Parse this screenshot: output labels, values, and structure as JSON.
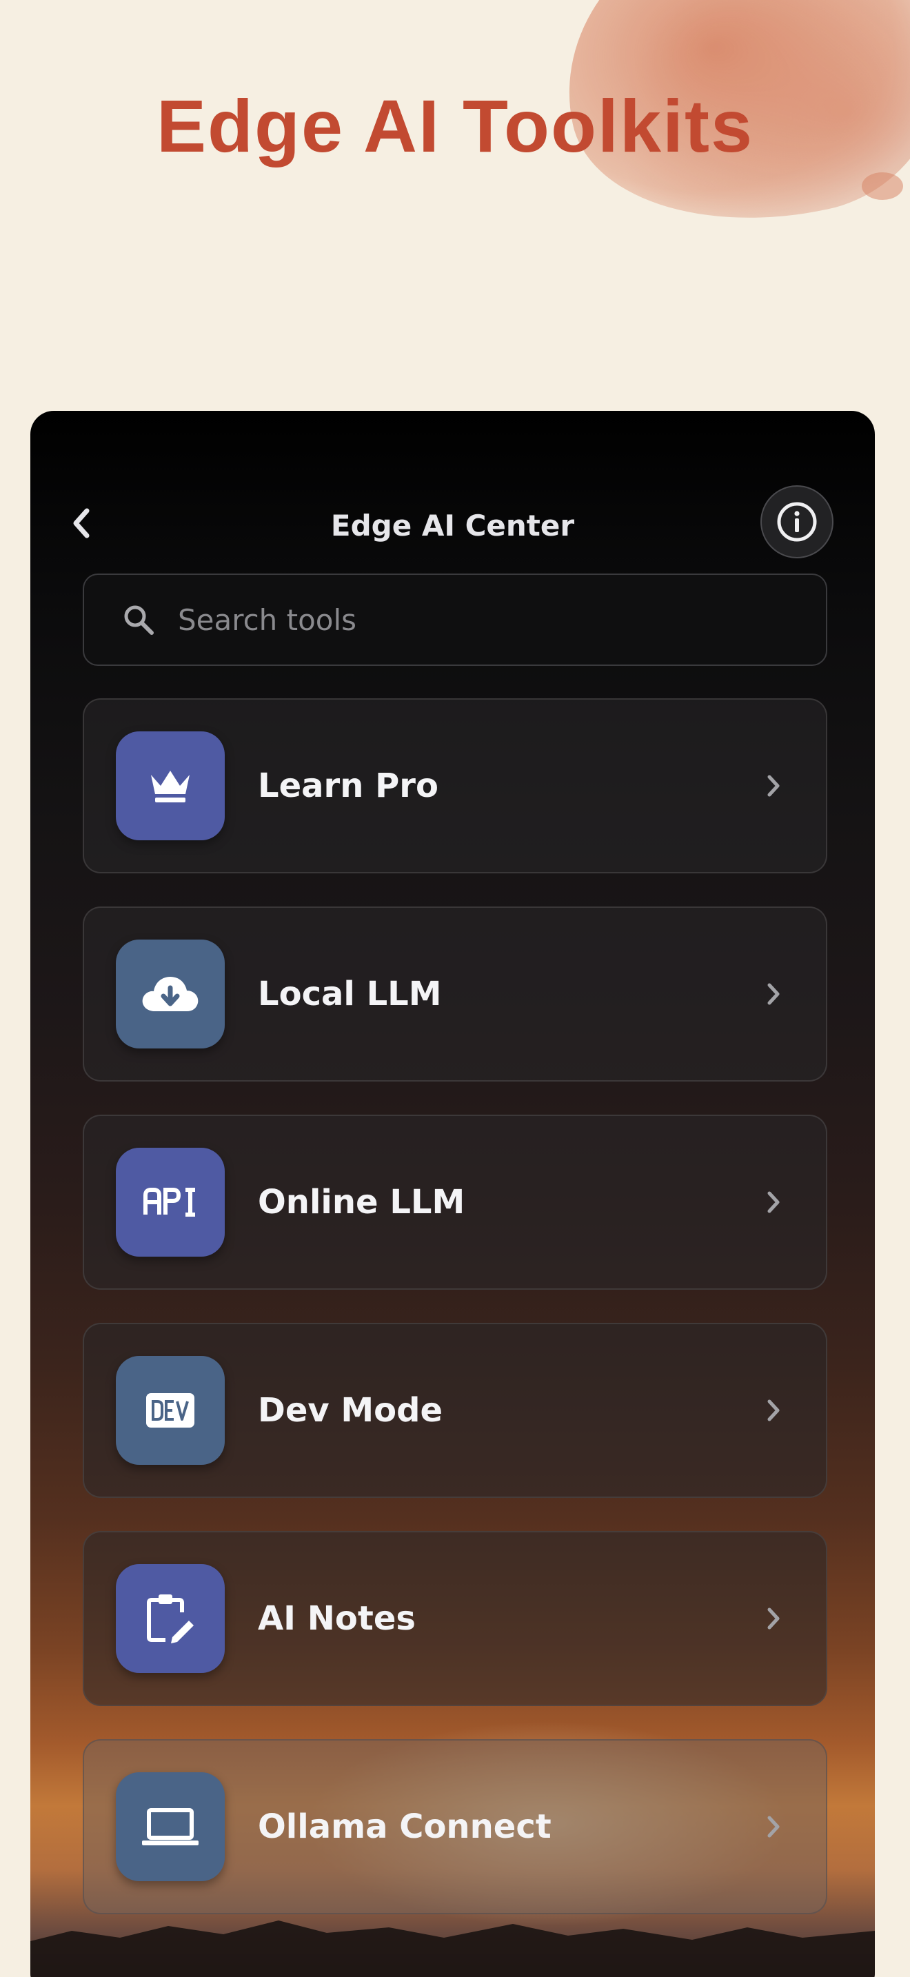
{
  "headline": "Edge AI Toolkits",
  "colors": {
    "headline": "#c24a31",
    "page_background": "#f6efe2",
    "icon_indigo": "#4f5aa3",
    "icon_slate": "#4a6487"
  },
  "navbar": {
    "back_icon": "chevron-left-icon",
    "title": "Edge AI Center",
    "info_icon": "info-circle-icon"
  },
  "search": {
    "icon": "search-icon",
    "placeholder": "Search tools",
    "value": ""
  },
  "tools": [
    {
      "label": "Learn Pro",
      "icon": "crown-icon",
      "color": "#4f5aa3"
    },
    {
      "label": "Local LLM",
      "icon": "cloud-download-icon",
      "color": "#4a6487"
    },
    {
      "label": "Online LLM",
      "icon": "api-icon",
      "color": "#4f5aa3"
    },
    {
      "label": "Dev Mode",
      "icon": "dev-badge-icon",
      "color": "#4a6487"
    },
    {
      "label": "AI Notes",
      "icon": "clipboard-edit-icon",
      "color": "#4f5aa3"
    },
    {
      "label": "Ollama Connect",
      "icon": "laptop-icon",
      "color": "#4a6487"
    }
  ]
}
